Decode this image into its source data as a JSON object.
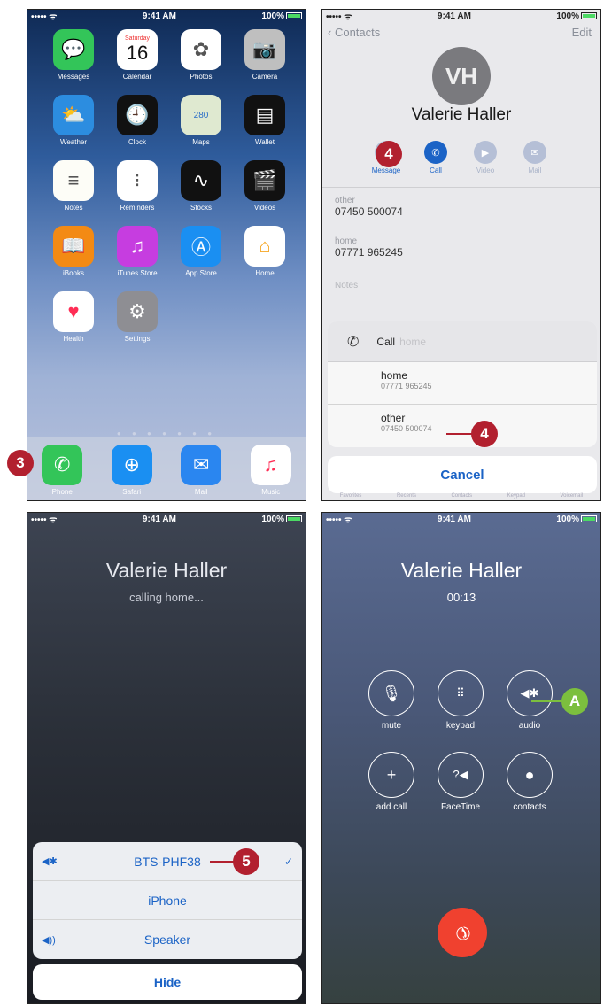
{
  "status": {
    "signal": "••••• ᯤ",
    "time": "9:41 AM",
    "battery": "100%"
  },
  "home": {
    "apps": [
      {
        "label": "Messages",
        "icon": "messages-icon",
        "color": "#33c559",
        "glyph": "💬"
      },
      {
        "label": "Calendar",
        "icon": "calendar-icon",
        "color": "#ffffff",
        "day": "Saturday",
        "date": "16"
      },
      {
        "label": "Photos",
        "icon": "photos-icon",
        "color": "#ffffff",
        "glyph": "✿"
      },
      {
        "label": "Camera",
        "icon": "camera-icon",
        "color": "#bfbfbf",
        "glyph": "📷"
      },
      {
        "label": "Weather",
        "icon": "weather-icon",
        "color": "#2c8de0",
        "glyph": "⛅"
      },
      {
        "label": "Clock",
        "icon": "clock-icon",
        "color": "#111111",
        "glyph": "🕘"
      },
      {
        "label": "Maps",
        "icon": "maps-icon",
        "color": "#dfe9d0",
        "glyph": "280"
      },
      {
        "label": "Wallet",
        "icon": "wallet-icon",
        "color": "#111111",
        "glyph": "▤"
      },
      {
        "label": "Notes",
        "icon": "notes-icon",
        "color": "#fdfdf7",
        "glyph": "≡"
      },
      {
        "label": "Reminders",
        "icon": "reminders-icon",
        "color": "#ffffff",
        "glyph": "⁝"
      },
      {
        "label": "Stocks",
        "icon": "stocks-icon",
        "color": "#111111",
        "glyph": "∿"
      },
      {
        "label": "Videos",
        "icon": "videos-icon",
        "color": "#111111",
        "glyph": "🎬"
      },
      {
        "label": "iBooks",
        "icon": "ibooks-icon",
        "color": "#f38a14",
        "glyph": "📖"
      },
      {
        "label": "iTunes Store",
        "icon": "itunes-store-icon",
        "color": "#c63de0",
        "glyph": "♫"
      },
      {
        "label": "App Store",
        "icon": "app-store-icon",
        "color": "#1a8ff2",
        "glyph": "Ⓐ"
      },
      {
        "label": "Home",
        "icon": "home-icon",
        "color": "#ffffff",
        "glyph": "⌂"
      },
      {
        "label": "Health",
        "icon": "health-icon",
        "color": "#ffffff",
        "glyph": "♥"
      },
      {
        "label": "Settings",
        "icon": "settings-icon",
        "color": "#8e8e93",
        "glyph": "⚙"
      }
    ],
    "dock": [
      {
        "label": "Phone",
        "icon": "phone-icon",
        "color": "#33c559",
        "glyph": "✆"
      },
      {
        "label": "Safari",
        "icon": "safari-icon",
        "color": "#1a8ff2",
        "glyph": "⊕"
      },
      {
        "label": "Mail",
        "icon": "mail-icon",
        "color": "#2a86f0",
        "glyph": "✉"
      },
      {
        "label": "Music",
        "icon": "music-icon",
        "color": "#ffffff",
        "glyph": "♫"
      }
    ],
    "callout": "3"
  },
  "contact": {
    "back_label": "Contacts",
    "edit_label": "Edit",
    "initials": "VH",
    "name": "Valerie Haller",
    "actions": [
      "Message",
      "Call",
      "Video",
      "Mail"
    ],
    "phones": [
      {
        "type": "other",
        "number": "07450 500074"
      },
      {
        "type": "home",
        "number": "07771 965245"
      }
    ],
    "notes_label": "Notes",
    "sheet": {
      "title": "Call",
      "title_hint": "home",
      "options": [
        {
          "label": "home",
          "number": "07771 965245"
        },
        {
          "label": "other",
          "number": "07450 500074"
        }
      ],
      "cancel": "Cancel"
    },
    "tabbar": [
      "Favorites",
      "Recents",
      "Contacts",
      "Keypad",
      "Voicemail"
    ],
    "callout_top": "4",
    "callout_sheet": "4"
  },
  "calling": {
    "name": "Valerie Haller",
    "status": "calling home...",
    "routes": [
      {
        "label": "BTS-PHF38",
        "selected": true
      },
      {
        "label": "iPhone",
        "selected": false
      },
      {
        "label": "Speaker",
        "selected": false
      }
    ],
    "check": "✓",
    "hide": "Hide",
    "callout": "5"
  },
  "incall": {
    "name": "Valerie Haller",
    "duration": "00:13",
    "buttons": [
      {
        "label": "mute",
        "icon": "mute-icon",
        "glyph": "🎙"
      },
      {
        "label": "keypad",
        "icon": "keypad-icon",
        "glyph": "⠿"
      },
      {
        "label": "audio",
        "icon": "audio-bluetooth-icon",
        "glyph": "◀✱"
      },
      {
        "label": "add call",
        "icon": "add-call-icon",
        "glyph": "+"
      },
      {
        "label": "FaceTime",
        "icon": "facetime-icon",
        "glyph": "?◀"
      },
      {
        "label": "contacts",
        "icon": "contacts-icon",
        "glyph": "●"
      }
    ],
    "callout": "A",
    "end_color": "#f0412f"
  }
}
